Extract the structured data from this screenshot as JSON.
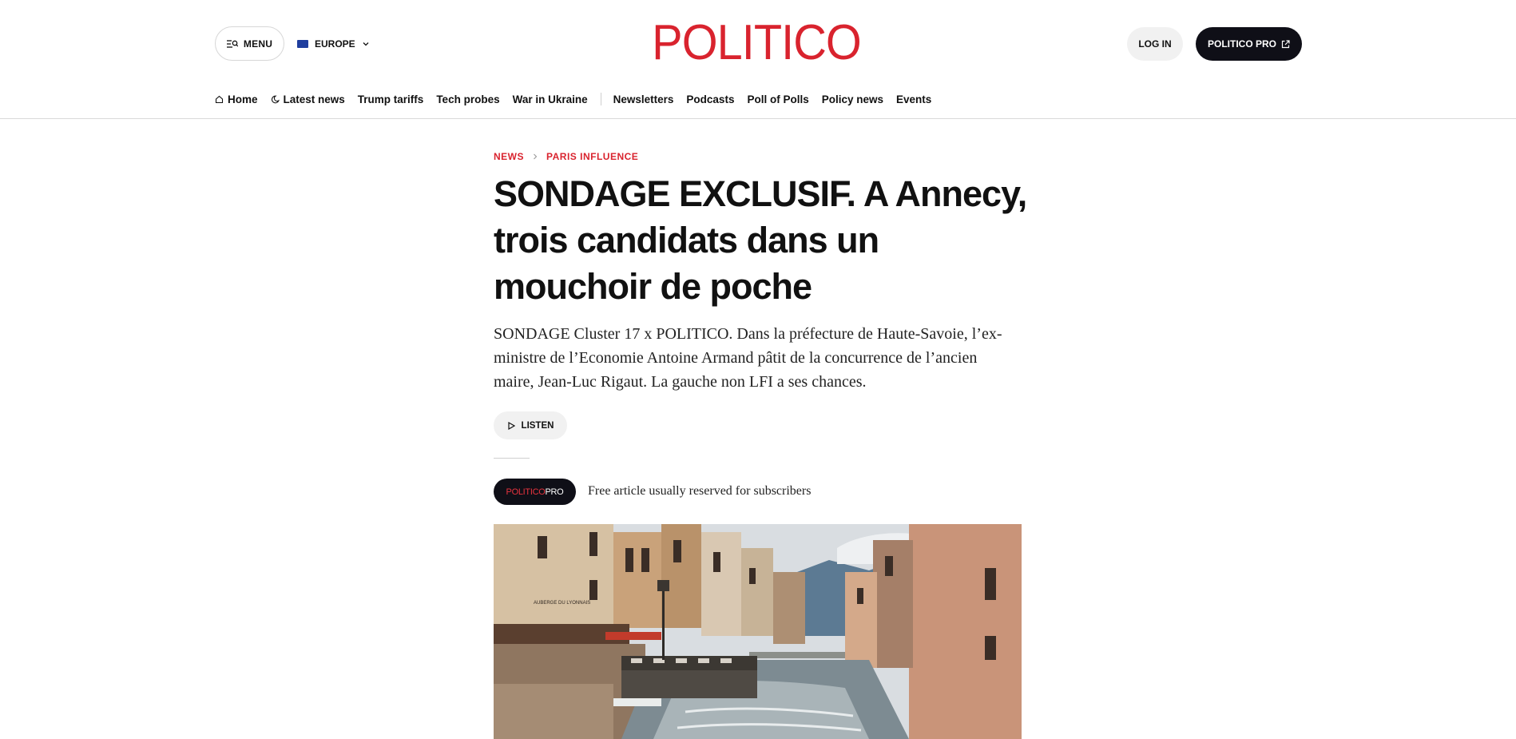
{
  "header": {
    "menu_label": "MENU",
    "edition_label": "EUROPE",
    "logo_text": "POLITICO",
    "login_label": "LOG IN",
    "pro_label": "POLITICO PRO"
  },
  "nav": {
    "items": [
      {
        "label": "Home",
        "icon": "home-icon"
      },
      {
        "label": "Latest news",
        "icon": "moon-icon"
      },
      {
        "label": "Trump tariffs"
      },
      {
        "label": "Tech probes"
      },
      {
        "label": "War in Ukraine"
      },
      {
        "label": "Newsletters"
      },
      {
        "label": "Podcasts"
      },
      {
        "label": "Poll of Polls"
      },
      {
        "label": "Policy news"
      },
      {
        "label": "Events"
      }
    ]
  },
  "article": {
    "breadcrumb": [
      "NEWS",
      "PARIS INFLUENCE"
    ],
    "headline": "SONDAGE EXCLUSIF. A Annecy, trois candidats dans un mouchoir de poche",
    "dek": "SONDAGE Cluster 17 x POLITICO. Dans la préfecture de Haute-Savoie, l’ex-ministre de l’Economie Antoine Armand pâtit de la concurrence de l’ancien maire, Jean-Luc Rigaut. La gauche non LFI a ses chances.",
    "listen_label": "LISTEN",
    "pro_badge": {
      "part1": "POLITICO",
      "part2": "PRO"
    },
    "free_note": "Free article usually reserved for subscribers"
  },
  "colors": {
    "brand_red": "#d9232e",
    "dark": "#0f0f17",
    "pill_grey": "#f1f1f1"
  }
}
